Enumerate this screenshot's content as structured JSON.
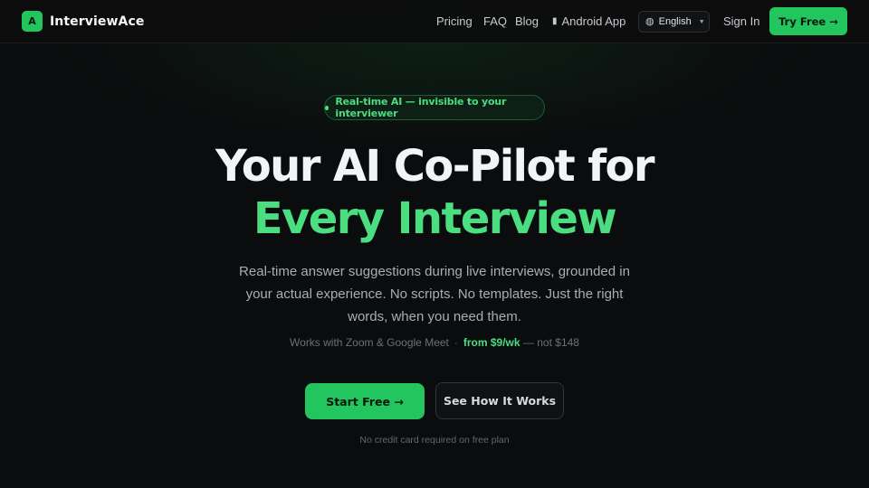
{
  "nav": {
    "logo_letter": "A",
    "brand": "InterviewAce",
    "links": [
      "Pricing",
      "FAQ",
      "Blog",
      "Android App"
    ],
    "phone_icon": "phone-icon",
    "language": "English",
    "sign_in": "Sign In",
    "try_free": "Try Free →"
  },
  "hero": {
    "badge": "Real-time AI — invisible to your interviewer",
    "title_line1": "Your AI Co-Pilot for",
    "title_line2": "Every Interview",
    "subtitle": "Real-time answer suggestions during live interviews, grounded in your actual experience. No scripts. No templates. Just the right words, when you need them.",
    "compat": "Works with Zoom & Google Meet",
    "separator": "·",
    "price": "from $9/wk",
    "price_old": "— not $148",
    "cta_primary": "Start Free →",
    "cta_secondary": "See How It Works",
    "note": "No credit card required on free plan"
  },
  "colors": {
    "accent": "#22c55e",
    "accent_text": "#4ade80",
    "background": "#0b0c0d"
  }
}
